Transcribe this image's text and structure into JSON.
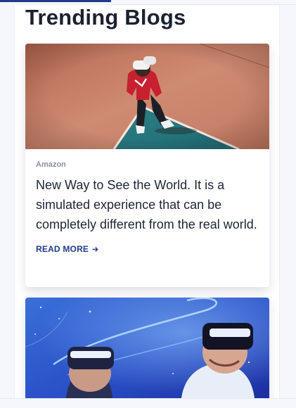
{
  "section": {
    "title": "Trending Blogs"
  },
  "blogs": [
    {
      "image_icon": "vr-person-on-court-image",
      "source": "Amazon",
      "title": "New Way to See the World. It is a simulated experience that can be completely different from the real world.",
      "read_more": "READ MORE",
      "read_more_icon": "arrow-right-icon"
    },
    {
      "image_icon": "vr-headset-users-image"
    }
  ],
  "colors": {
    "accent": "#1f3c8a",
    "heading": "#1b2130",
    "muted": "#8a909c",
    "page_bg": "#f5f7fc"
  }
}
